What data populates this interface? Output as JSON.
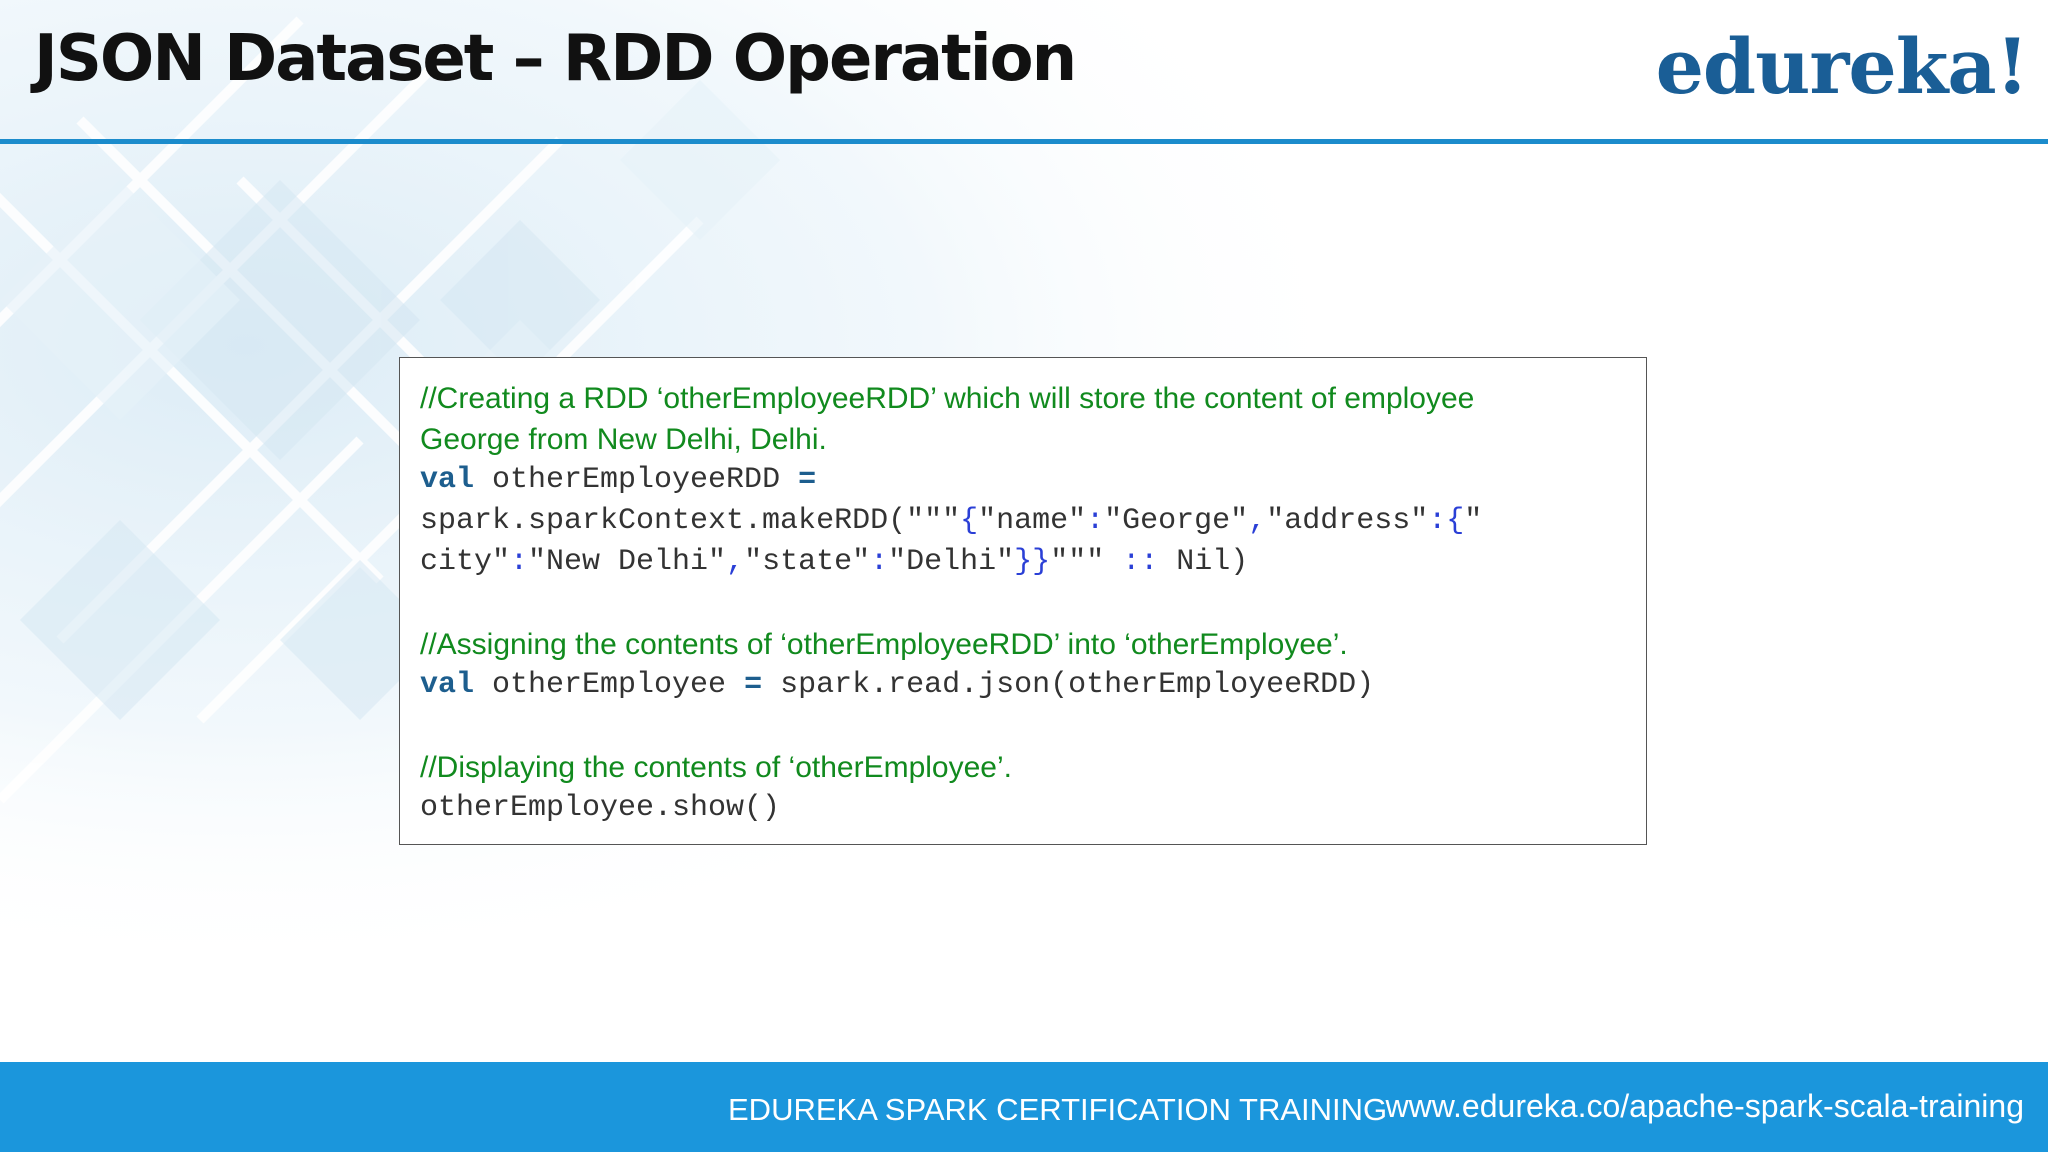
{
  "slide": {
    "title": "JSON Dataset – RDD Operation",
    "logo_text": "edureka!"
  },
  "code": {
    "comment1_line1": "//Creating a RDD ‘otherEmployeeRDD’ which will store the content of employee",
    "comment1_line2": "George from New Delhi, Delhi.",
    "l3_kw": "val",
    "l3_ident": " otherEmployeeRDD ",
    "l3_op": "=",
    "l4_a": "spark.sparkContext.makeRDD(\"\"\"",
    "l4_brace": "{",
    "l4_b": "\"name\"",
    "l4_colon": ":",
    "l4_c": "\"George\"",
    "l4_comma": ",",
    "l4_d": "\"address\"",
    "l4_colon2": ":",
    "l4_brace2": "{",
    "l4_e": "\"",
    "l5_a": "city\"",
    "l5_colon": ":",
    "l5_b": "\"New Delhi\"",
    "l5_comma": ",",
    "l5_c": "\"state\"",
    "l5_colon2": ":",
    "l5_d": "\"Delhi\"",
    "l5_braces": "}}",
    "l5_e": "\"\"\" ",
    "l5_colons": "::",
    "l5_f": " Nil)",
    "comment2": "//Assigning the contents of ‘otherEmployeeRDD’ into ‘otherEmployee’.",
    "l8_kw": "val",
    "l8_ident": " otherEmployee ",
    "l8_op": "=",
    "l8_rest": " spark.read.json(otherEmployeeRDD)",
    "comment3": "//Displaying the contents of ‘otherEmployee’.",
    "l11": "otherEmployee.show()"
  },
  "footer": {
    "left_text": "EDUREKA SPARK CERTIFICATION TRAINING",
    "right_text": "www.edureka.co/apache-spark-scala-training"
  },
  "colors": {
    "accent_blue": "#1c8ccc",
    "footer_blue": "#1b96dc",
    "logo_blue": "#1a5e96",
    "comment_green": "#118a1e",
    "keyword_blue": "#1d5e8e"
  }
}
